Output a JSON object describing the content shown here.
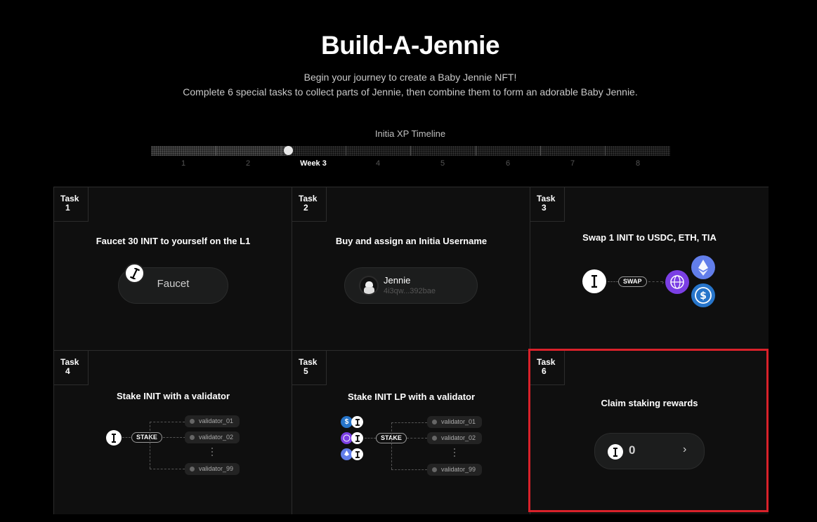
{
  "header": {
    "title": "Build-A-Jennie",
    "line1": "Begin your journey to create a Baby Jennie NFT!",
    "line2": "Complete 6 special tasks to collect parts of Jennie, then combine them to form an adorable Baby Jennie."
  },
  "timeline": {
    "title": "Initia XP Timeline",
    "labels": [
      "1",
      "2",
      "Week 3",
      "4",
      "5",
      "6",
      "7",
      "8"
    ],
    "progress_weeks": 3
  },
  "tasks": [
    {
      "tag": "Task",
      "num": "1",
      "title": "Faucet 30 INIT to yourself on the L1",
      "button": "Faucet"
    },
    {
      "tag": "Task",
      "num": "2",
      "title": "Buy and assign an Initia Username",
      "username": "Jennie",
      "address": "4i3qw...392bae"
    },
    {
      "tag": "Task",
      "num": "3",
      "title": "Swap 1 INIT to USDC, ETH, TIA",
      "swap_label": "SWAP"
    },
    {
      "tag": "Task",
      "num": "4",
      "title": "Stake INIT with a validator",
      "stake_label": "STAKE",
      "validators": [
        "validator_01",
        "validator_02",
        "validator_99"
      ]
    },
    {
      "tag": "Task",
      "num": "5",
      "title": "Stake INIT LP with a validator",
      "stake_label": "STAKE",
      "validators": [
        "validator_01",
        "validator_02",
        "validator_99"
      ]
    },
    {
      "tag": "Task",
      "num": "6",
      "title": "Claim staking rewards",
      "reward_value": "0"
    }
  ],
  "colors": {
    "highlight": "#d9212a",
    "tia": "#7b3fe4",
    "eth": "#627eea",
    "usdc": "#2775ca"
  }
}
